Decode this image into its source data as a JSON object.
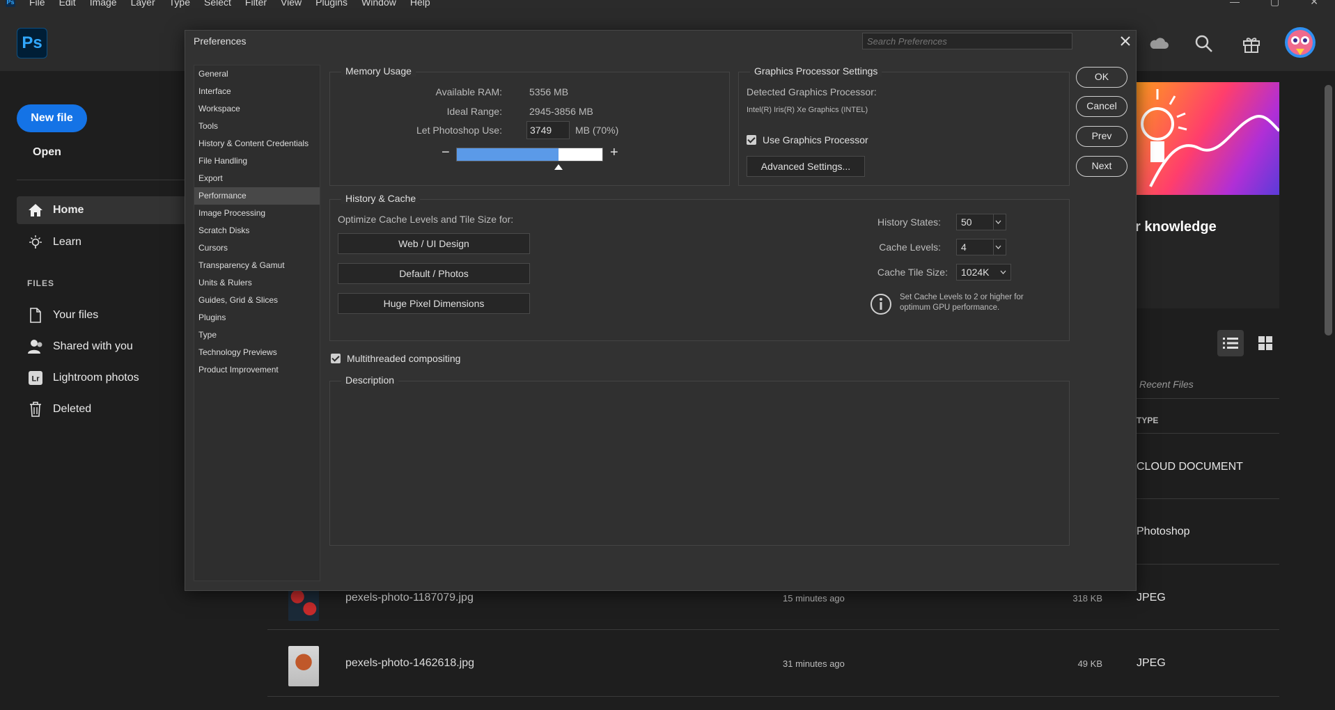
{
  "menubar": {
    "app_icon": "Ps",
    "items": [
      "File",
      "Edit",
      "Image",
      "Layer",
      "Type",
      "Select",
      "Filter",
      "View",
      "Plugins",
      "Window",
      "Help"
    ]
  },
  "header": {
    "logo": "Ps",
    "icons": [
      "cloud-icon",
      "search-icon",
      "gift-icon",
      "avatar"
    ]
  },
  "sidebar": {
    "new_file": "New file",
    "open": "Open",
    "nav": [
      {
        "label": "Home",
        "icon": "home-icon",
        "active": true
      },
      {
        "label": "Learn",
        "icon": "lightbulb-icon",
        "active": false
      }
    ],
    "files_heading": "FILES",
    "files": [
      {
        "label": "Your files",
        "icon": "file-icon"
      },
      {
        "label": "Shared with you",
        "icon": "people-icon"
      },
      {
        "label": "Lightroom photos",
        "icon": "lightroom-icon"
      },
      {
        "label": "Deleted",
        "icon": "trash-icon"
      }
    ]
  },
  "main": {
    "promo_text": "r knowledge",
    "recent_files_label": "Recent Files",
    "type_header": "TYPE",
    "type_rows": [
      "CLOUD DOCUMENT",
      "Photoshop"
    ],
    "files": [
      {
        "name": "pexels-photo-1187079.jpg",
        "modified": "15 minutes ago",
        "size": "318 KB",
        "type": "JPEG"
      },
      {
        "name": "pexels-photo-1462618.jpg",
        "modified": "31 minutes ago",
        "size": "49 KB",
        "type": "JPEG"
      }
    ]
  },
  "dialog": {
    "title": "Preferences",
    "search_placeholder": "Search Preferences",
    "nav": [
      "General",
      "Interface",
      "Workspace",
      "Tools",
      "History & Content Credentials",
      "File Handling",
      "Export",
      "Performance",
      "Image Processing",
      "Scratch Disks",
      "Cursors",
      "Transparency & Gamut",
      "Units & Rulers",
      "Guides, Grid & Slices",
      "Plugins",
      "Type",
      "Technology Previews",
      "Product Improvement"
    ],
    "selected_nav": "Performance",
    "memory": {
      "title": "Memory Usage",
      "available_label": "Available RAM:",
      "available_value": "5356 MB",
      "ideal_label": "Ideal Range:",
      "ideal_value": "2945-3856 MB",
      "let_label": "Let Photoshop Use:",
      "let_value": "3749",
      "let_unit": "MB (70%)",
      "minus": "−",
      "plus": "+",
      "slider_fraction": 0.7
    },
    "gpu": {
      "title": "Graphics Processor Settings",
      "detected_label": "Detected Graphics Processor:",
      "detected_value": "Intel(R) Iris(R) Xe Graphics (INTEL)",
      "use_gpu_label": "Use Graphics Processor",
      "use_gpu_checked": true,
      "advanced_btn": "Advanced Settings..."
    },
    "history_cache": {
      "title": "History & Cache",
      "optimize_label": "Optimize Cache Levels and Tile Size for:",
      "buttons": [
        "Web / UI Design",
        "Default / Photos",
        "Huge Pixel Dimensions"
      ],
      "history_states_label": "History States:",
      "history_states_value": "50",
      "cache_levels_label": "Cache Levels:",
      "cache_levels_value": "4",
      "cache_tile_label": "Cache Tile Size:",
      "cache_tile_value": "1024K",
      "info_line1": "Set Cache Levels to 2 or higher for",
      "info_line2": "optimum GPU performance."
    },
    "multithreaded_label": "Multithreaded compositing",
    "multithreaded_checked": true,
    "description_title": "Description",
    "actions": {
      "ok": "OK",
      "cancel": "Cancel",
      "prev": "Prev",
      "next": "Next"
    }
  }
}
